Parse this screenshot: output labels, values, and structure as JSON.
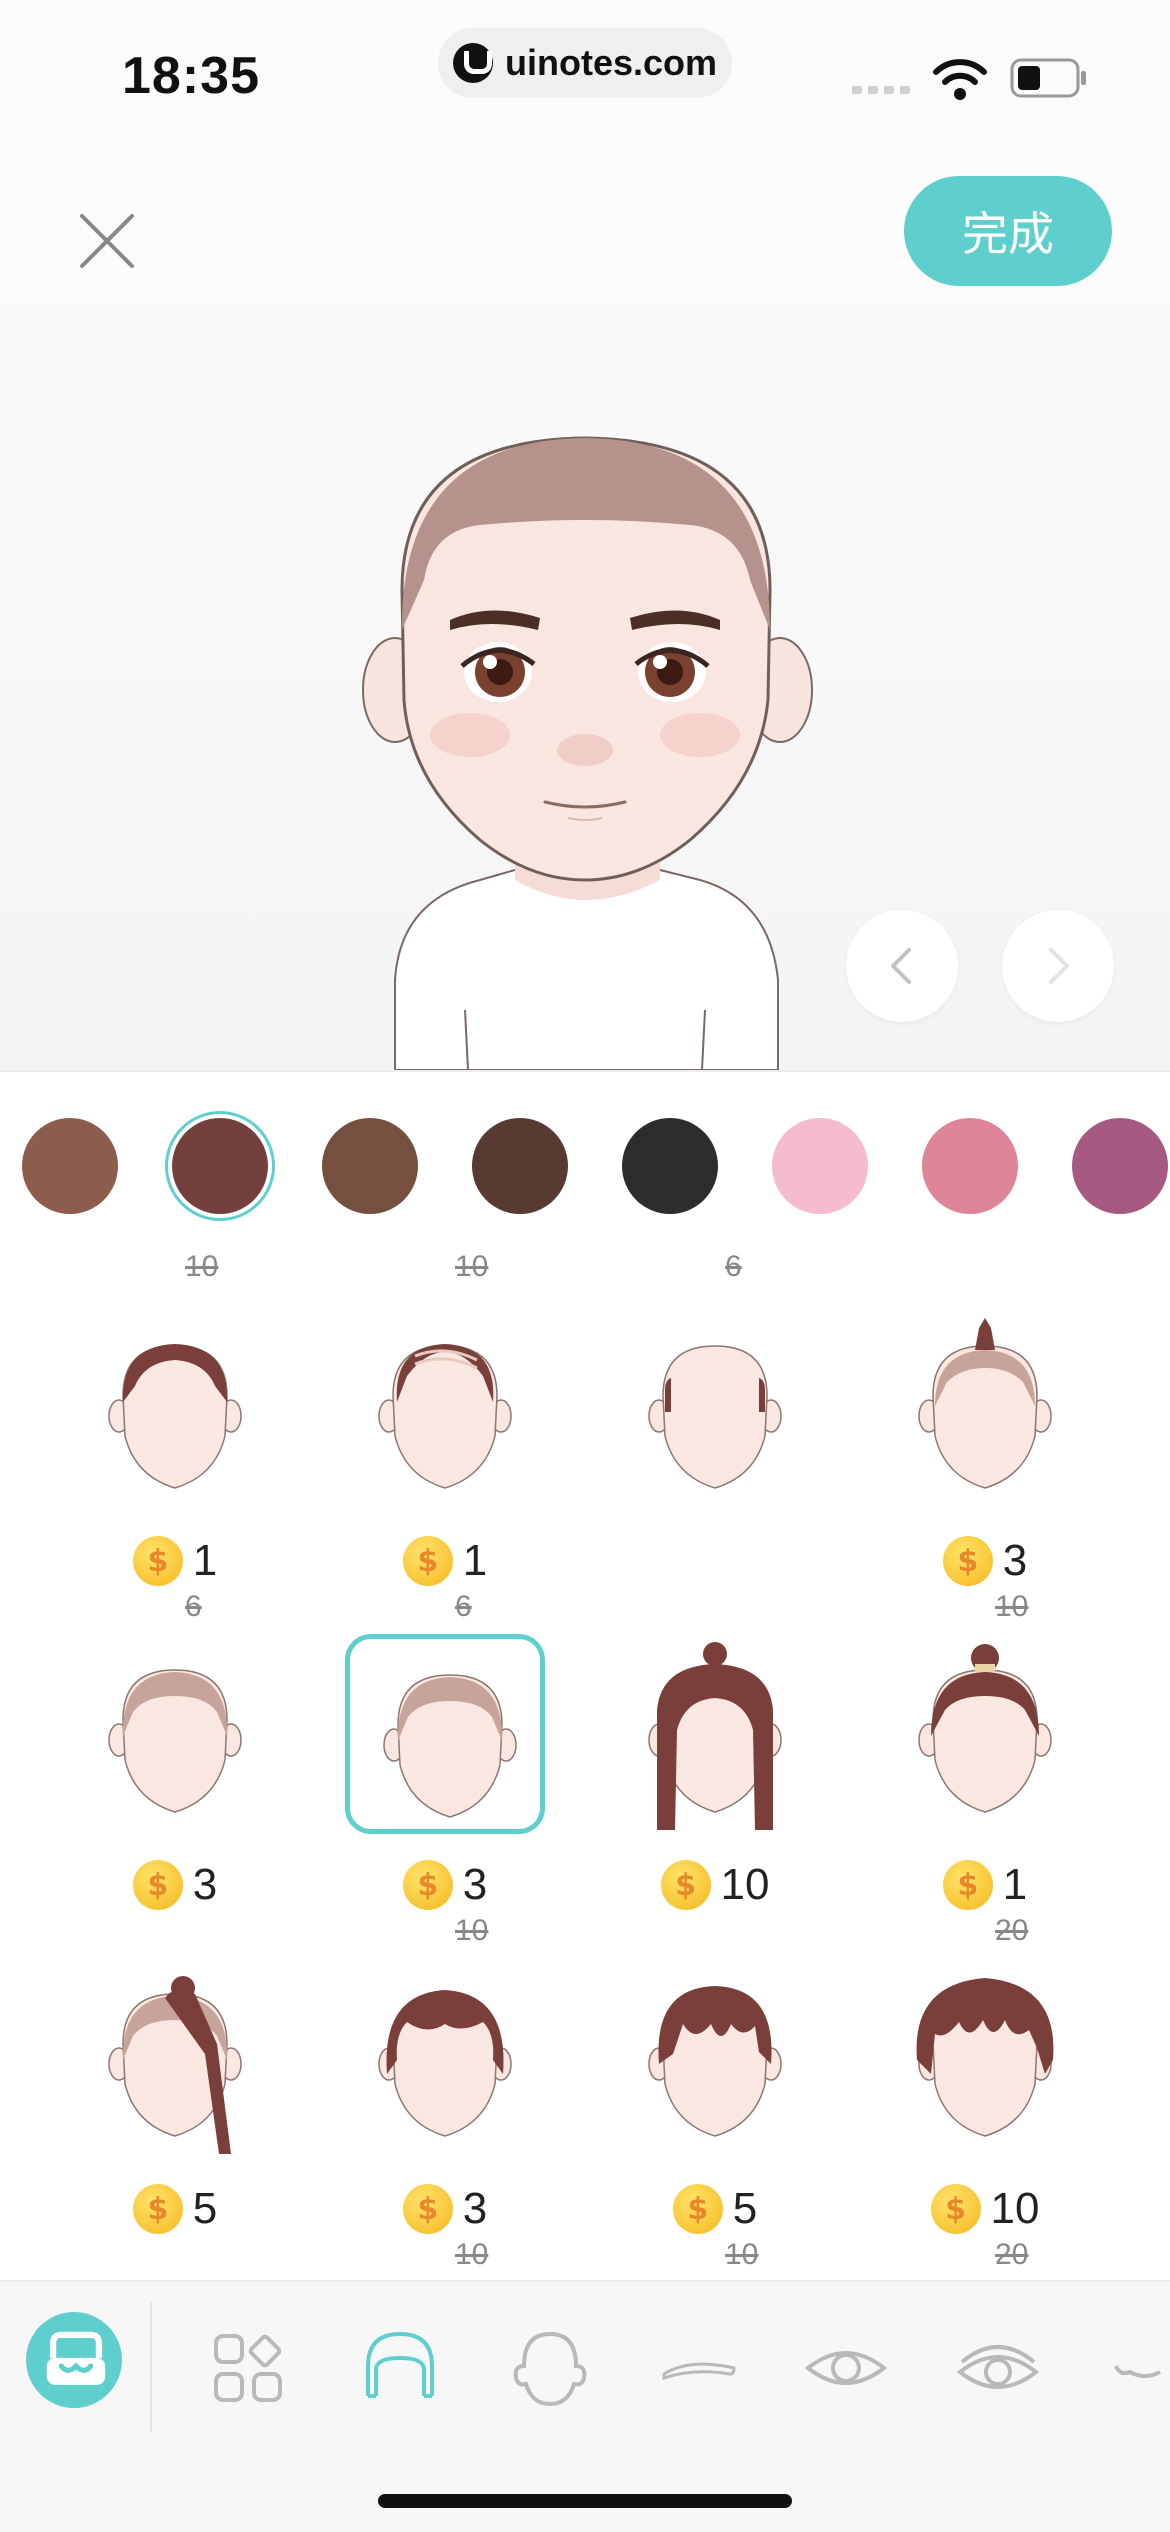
{
  "status_bar": {
    "time": "18:35",
    "url": "uinotes.com"
  },
  "header": {
    "done_label": "完成"
  },
  "colors": {
    "accent": "#5fcfcd",
    "swatches": [
      "#8e5c4c",
      "#73403d",
      "#76503f",
      "#583a32",
      "#2e2c2d",
      "#f4bccc",
      "#de8599",
      "#a65a82"
    ],
    "selected_swatch_index": 1
  },
  "hair_items": [
    {
      "price": "1",
      "old_price": "6"
    },
    {
      "price": "1",
      "old_price": "6"
    },
    {
      "price": "",
      "old_price": ""
    },
    {
      "price": "3",
      "old_price": "10"
    },
    {
      "price": "3",
      "old_price": ""
    },
    {
      "price": "3",
      "old_price": "10"
    },
    {
      "price": "10",
      "old_price": ""
    },
    {
      "price": "1",
      "old_price": "20"
    },
    {
      "price": "5",
      "old_price": ""
    },
    {
      "price": "3",
      "old_price": "10"
    },
    {
      "price": "5",
      "old_price": "10"
    },
    {
      "price": "10",
      "old_price": "20"
    }
  ],
  "previous_row_old_prices": [
    "10",
    "10",
    "6"
  ],
  "selected_hair_index": 5,
  "coin_symbol": "$",
  "toolbar": {
    "items": [
      "store-icon",
      "categories-icon",
      "hair-icon",
      "face-icon",
      "eyebrow-icon",
      "eye-icon",
      "eye-makeup-icon",
      "mouth-icon"
    ],
    "active": "hair-icon"
  }
}
